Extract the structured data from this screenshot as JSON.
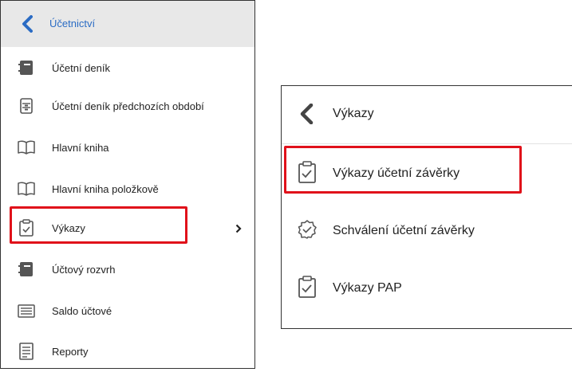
{
  "left_menu": {
    "header": {
      "title": "Účetnictví"
    },
    "items": [
      {
        "label": "Účetní deník",
        "icon": "journal-icon"
      },
      {
        "label": "Účetní deník předchozích období",
        "icon": "archive-journal-icon"
      },
      {
        "label": "Hlavní kniha",
        "icon": "open-book-icon"
      },
      {
        "label": "Hlavní kniha položkově",
        "icon": "open-book-icon"
      },
      {
        "label": "Výkazy",
        "icon": "clipboard-check-icon",
        "has_submenu": true
      },
      {
        "label": "Účtový rozvrh",
        "icon": "journal-icon"
      },
      {
        "label": "Saldo účtové",
        "icon": "list-icon"
      },
      {
        "label": "Reporty",
        "icon": "report-icon"
      }
    ]
  },
  "submenu": {
    "header": {
      "title": "Výkazy"
    },
    "items": [
      {
        "label": "Výkazy účetní závěrky",
        "icon": "clipboard-check-icon"
      },
      {
        "label": "Schválení účetní závěrky",
        "icon": "verified-badge-icon"
      },
      {
        "label": "Výkazy PAP",
        "icon": "clipboard-check-icon"
      }
    ]
  },
  "colors": {
    "accent": "#2b6cc4",
    "highlight": "#e0111a",
    "icon": "#555555",
    "header_bg": "#e8e8e8"
  }
}
